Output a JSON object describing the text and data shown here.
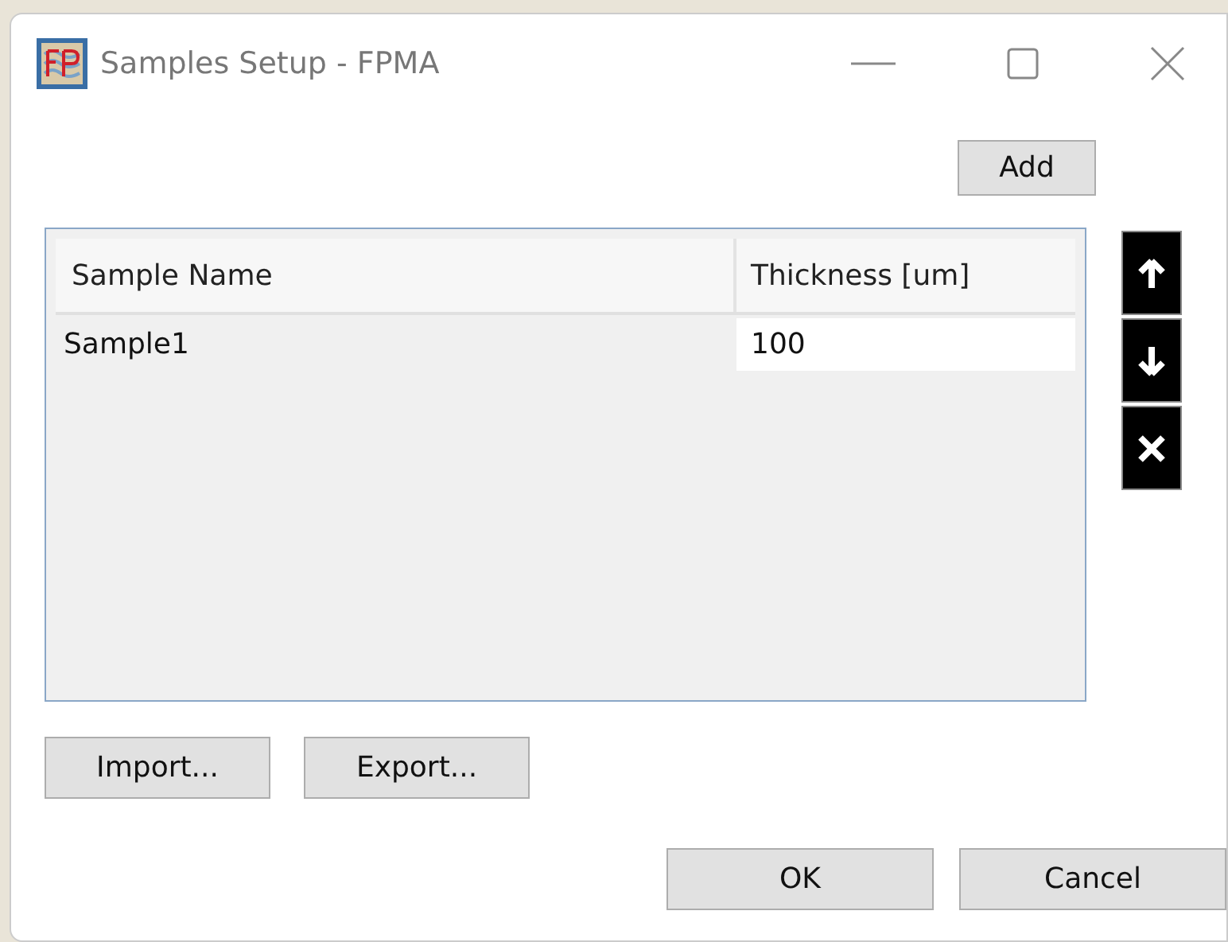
{
  "window": {
    "title": "Samples Setup - FPMA"
  },
  "add_button": "Add",
  "table": {
    "columns": [
      "Sample Name",
      "Thickness [um]"
    ],
    "rows": [
      {
        "cells": [
          "Sample1",
          "100"
        ]
      }
    ]
  },
  "side_buttons": [
    {
      "kind": "up"
    },
    {
      "kind": "down"
    },
    {
      "kind": "delete"
    }
  ],
  "import_button": "Import...",
  "export_button": "Export...",
  "buttons": [
    "OK",
    "Cancel"
  ]
}
